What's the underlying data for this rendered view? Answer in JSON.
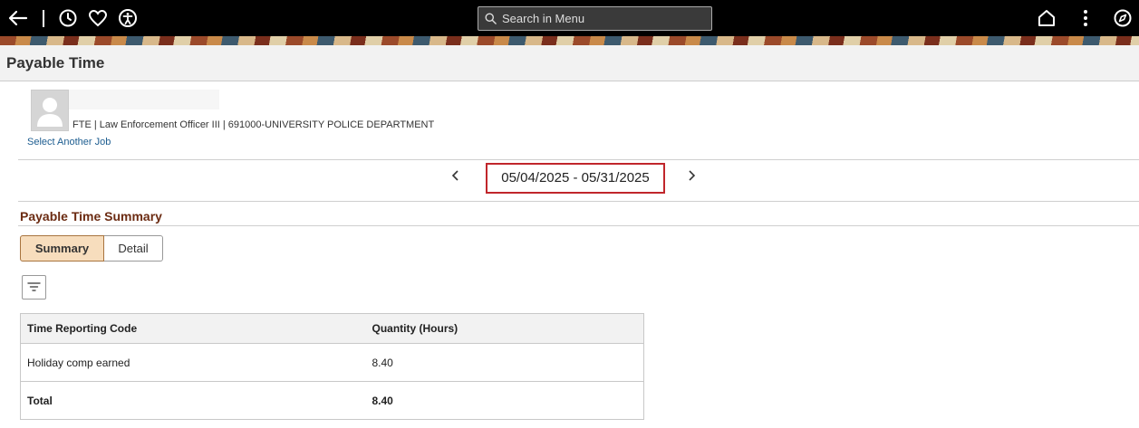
{
  "topbar": {
    "search_placeholder": "Search in Menu"
  },
  "page": {
    "title": "Payable Time"
  },
  "employee": {
    "job_info": "FTE | Law Enforcement Officer III | 691000-UNIVERSITY POLICE DEPARTMENT",
    "select_job_label": "Select Another Job"
  },
  "period": {
    "range": "05/04/2025 - 05/31/2025"
  },
  "summary": {
    "section_title": "Payable Time Summary",
    "tabs": [
      {
        "label": "Summary",
        "active": true
      },
      {
        "label": "Detail",
        "active": false
      }
    ],
    "columns": [
      "Time Reporting Code",
      "Quantity (Hours)"
    ],
    "rows": [
      {
        "code": "Holiday comp earned",
        "quantity": "8.40"
      }
    ],
    "total": {
      "label": "Total",
      "quantity": "8.40"
    }
  },
  "colors": {
    "accent_tab_bg": "#f7ddbd",
    "section_title": "#6b2b12",
    "date_highlight": "#c0262b",
    "link": "#1d5d90"
  }
}
